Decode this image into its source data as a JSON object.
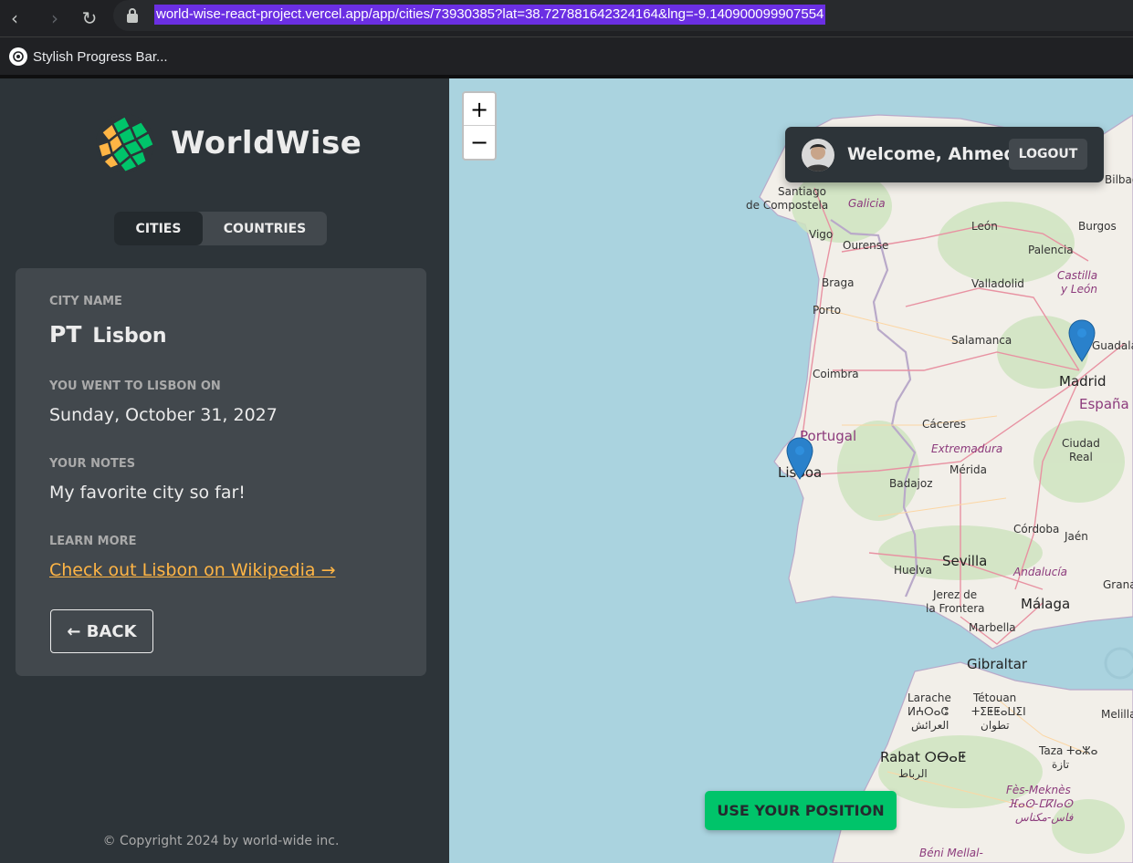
{
  "browser": {
    "url": "world-wise-react-project.vercel.app/app/cities/73930385?lat=38.727881642324164&lng=-9.140900099907554",
    "bookmark_label": "Stylish Progress Bar..."
  },
  "sidebar": {
    "logo_text": "WorldWise",
    "tabs": [
      {
        "label": "CITIES",
        "active": true
      },
      {
        "label": "COUNTRIES",
        "active": false
      }
    ],
    "city": {
      "city_name_label": "CITY NAME",
      "flag": "PT",
      "name": "Lisbon",
      "went_label": "YOU WENT TO LISBON ON",
      "date": "Sunday, October 31, 2027",
      "notes_label": "YOUR NOTES",
      "notes": "My favorite city so far!",
      "learn_label": "LEARN MORE",
      "wiki_link": "Check out Lisbon on Wikipedia →",
      "back_label": "← BACK"
    },
    "copyright": "© Copyright 2024 by world-wide inc."
  },
  "map": {
    "zoom_in": "+",
    "zoom_out": "−",
    "user": {
      "welcome": "Welcome, Ahmed",
      "logout_label": "LOGOUT"
    },
    "use_position_label": "USE YOUR POSITION",
    "places": {
      "santiago": "Santiago",
      "compostela": "de Compostela",
      "galicia": "Galicia",
      "bilbao": "Bilbao",
      "leon": "León",
      "burgos": "Burgos",
      "vigo": "Vigo",
      "ourense": "Ourense",
      "palencia": "Palencia",
      "castilla": "Castilla",
      "yleon": "y León",
      "braga": "Braga",
      "valladolid": "Valladolid",
      "porto": "Porto",
      "salamanca": "Salamanca",
      "guadalajara": "Guadalajara",
      "coimbra": "Coimbra",
      "madrid": "Madrid",
      "espana": "España",
      "portugal": "Portugal",
      "caceres": "Cáceres",
      "extremadura": "Extremadura",
      "ciudad": "Ciudad",
      "real": "Real",
      "lisboa": "Lisboa",
      "merida": "Mérida",
      "badajoz": "Badajoz",
      "cordoba": "Córdoba",
      "jaen": "Jaén",
      "sevilla": "Sevilla",
      "huelva": "Huelva",
      "andalucia": "Andalucía",
      "granada": "Granada",
      "jerez": "Jerez de",
      "frontera": "la Frontera",
      "malaga": "Málaga",
      "marbella": "Marbella",
      "gibraltar": "Gibraltar",
      "larache": "Larache",
      "larache_b": "ⵍⵄⵔⴰⵛ",
      "larache_ar": "العرائش",
      "tetouan": "Tétouan",
      "tetouan_b": "ⵜⵉⵟⵟⴰⵡⵉⵏ",
      "tetouan_ar": "تطوان",
      "melilla": "Melilla",
      "rabat": "Rabat ⵔⴱⴰⵟ",
      "rabat_ar": "الرباط",
      "taza": "Taza ⵜⴰⵣⴰ",
      "taza_ar": "تازة",
      "fes": "Fès-Meknès",
      "fes_b": "ⴼⴰⵙ-ⵎⴽⵏⴰⵙ",
      "fes_ar": "فاس-مكناس",
      "beni": "Béni Mellal-"
    }
  }
}
